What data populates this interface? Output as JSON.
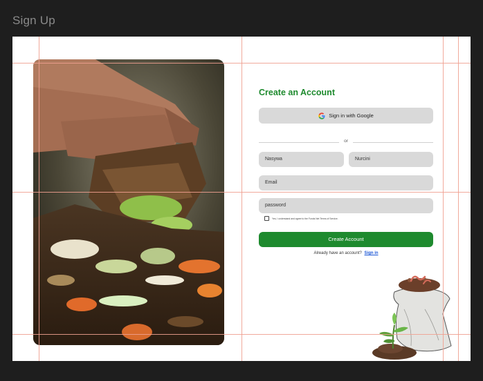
{
  "frame": {
    "label": "Sign Up"
  },
  "form": {
    "title": "Create an Account",
    "google_button": "Sign in with Google",
    "divider_text": "or",
    "first_name": "Nasywa",
    "last_name": "Nurcini",
    "email_placeholder": "Email",
    "password_placeholder": "password",
    "terms_text": "Yes, I understand and agree to the Funds Net Terms of Service.",
    "create_button": "Create Account",
    "signin_prompt": "Already have an account?",
    "signin_link": "Sign in"
  },
  "colors": {
    "brand_green": "#1e8a2e",
    "link_blue": "#1a56d6",
    "input_bg": "#d9d9d9",
    "guide": "#f0a090",
    "canvas_bg": "#1e1e1e"
  }
}
